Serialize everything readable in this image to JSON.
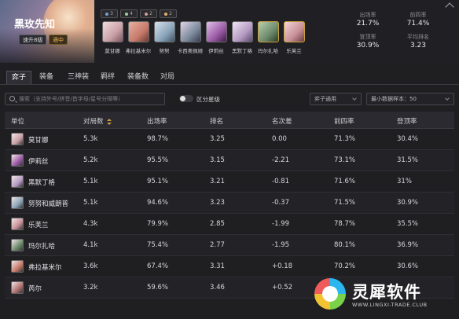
{
  "header": {
    "comp_name": "黑玫先知",
    "tags": {
      "upgrade": "速升8級",
      "tier": "適中"
    },
    "traits": [
      {
        "count": "3",
        "color": "#7b9fcf",
        "icon": "trait-a-icon"
      },
      {
        "count": "4",
        "color": "#9fd09a",
        "icon": "trait-b-icon"
      },
      {
        "count": "2",
        "color": "#d59b9b",
        "icon": "trait-c-icon"
      },
      {
        "count": "2",
        "color": "#e0b070",
        "icon": "trait-d-icon"
      }
    ],
    "champions": [
      {
        "name": "莫甘娜",
        "color": "#c9a0a6"
      },
      {
        "name": "弗拉基米尔",
        "color": "#c77a6a"
      },
      {
        "name": "努努",
        "color": "#8aa3b8"
      },
      {
        "name": "卡西奥佩娅",
        "color": "#7a8a9c"
      },
      {
        "name": "伊莉丝",
        "color": "#9a5aa5"
      },
      {
        "name": "黑默丁格",
        "color": "#b59ac2"
      },
      {
        "name": "玛尔扎哈",
        "color": "#6c8a6a"
      },
      {
        "name": "乐芙兰",
        "color": "#c78f95"
      }
    ],
    "stats": [
      {
        "label": "出场率",
        "value": "21.7%"
      },
      {
        "label": "前四率",
        "value": "71.4%"
      },
      {
        "label": "登顶率",
        "value": "30.9%"
      },
      {
        "label": "平均排名",
        "value": "3.23"
      }
    ]
  },
  "tabs": [
    "弈子",
    "装备",
    "三神装",
    "羁绊",
    "装备数",
    "对局"
  ],
  "filters": {
    "search_placeholder": "搜索（支持外号/拼音/首字母/星号分隔等）",
    "toggle_label": "区分星级",
    "select_1": "弈子通用",
    "select_2": "最小数据样本：50"
  },
  "table": {
    "headers": [
      "单位",
      "对局数",
      "出场率",
      "排名",
      "名次差",
      "前四率",
      "登顶率"
    ],
    "rows": [
      {
        "name": "莫甘娜",
        "icon_color": "#c9a0a6",
        "games": "5.3k",
        "rate": "98.7%",
        "rank": "3.25",
        "diff": "0.00",
        "top4": "71.3%",
        "win": "30.4%"
      },
      {
        "name": "伊莉丝",
        "icon_color": "#9a5aa5",
        "games": "5.2k",
        "rate": "95.5%",
        "rank": "3.15",
        "diff": "-2.21",
        "top4": "73.1%",
        "win": "31.5%"
      },
      {
        "name": "黑默丁格",
        "icon_color": "#b59ac2",
        "games": "5.1k",
        "rate": "95.1%",
        "rank": "3.21",
        "diff": "-0.81",
        "top4": "71.6%",
        "win": "31%"
      },
      {
        "name": "努努和威朗普",
        "icon_color": "#8aa3b8",
        "games": "5.1k",
        "rate": "94.6%",
        "rank": "3.23",
        "diff": "-0.37",
        "top4": "71.5%",
        "win": "30.9%"
      },
      {
        "name": "乐芙兰",
        "icon_color": "#c78f95",
        "games": "4.3k",
        "rate": "79.9%",
        "rank": "2.85",
        "diff": "-1.99",
        "top4": "78.7%",
        "win": "35.5%"
      },
      {
        "name": "玛尔扎哈",
        "icon_color": "#6c8a6a",
        "games": "4.1k",
        "rate": "75.4%",
        "rank": "2.77",
        "diff": "-1.95",
        "top4": "80.1%",
        "win": "36.9%"
      },
      {
        "name": "弗拉基米尔",
        "icon_color": "#c77a6a",
        "games": "3.6k",
        "rate": "67.4%",
        "rank": "3.31",
        "diff": "+0.18",
        "top4": "70.2%",
        "win": "30.6%"
      },
      {
        "name": "芮尔",
        "icon_color": "#b07070",
        "games": "3.2k",
        "rate": "59.6%",
        "rank": "3.46",
        "diff": "+0.52",
        "top4": "",
        "win": ""
      }
    ]
  },
  "watermark": {
    "brand": "灵犀软件",
    "url": "WWW.LINGXI-TRADE.CLUB"
  }
}
